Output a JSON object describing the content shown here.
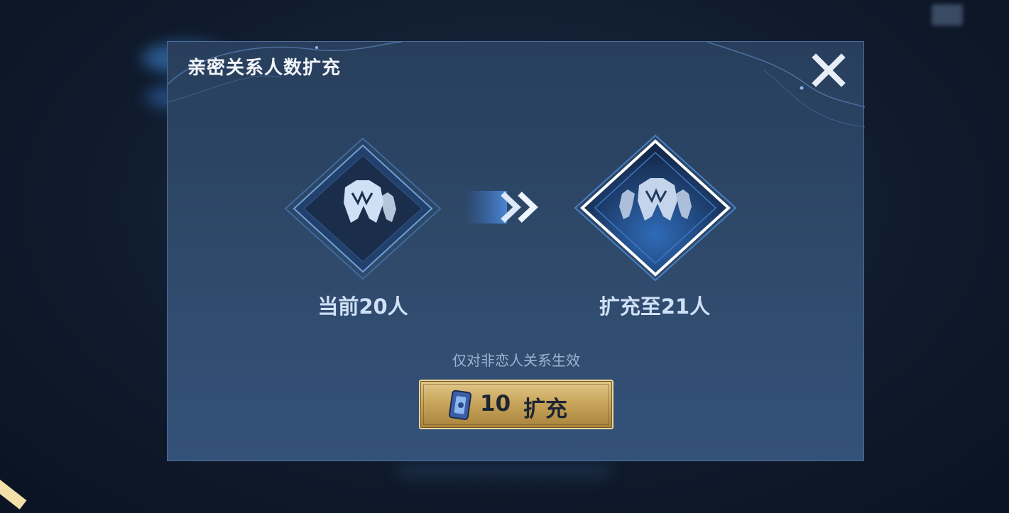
{
  "dialog": {
    "title": "亲密关系人数扩充",
    "current_label": "当前20人",
    "new_label": "扩充至21人",
    "note": "仅对非恋人关系生效",
    "button": {
      "cost": "10",
      "label": "扩充",
      "icon": "coupon-icon"
    },
    "close_icon": "close-icon",
    "badge_icon": "guardians-icon"
  },
  "colors": {
    "accent": "#4fa8ff",
    "gold": "#c9a65c",
    "panel": "#2f4a6b"
  }
}
